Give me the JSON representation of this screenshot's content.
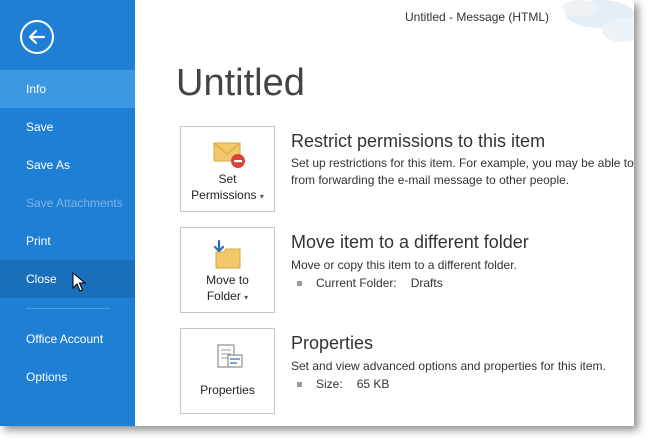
{
  "window": {
    "title": "Untitled - Message (HTML)"
  },
  "sidebar": {
    "back": "back-arrow-icon",
    "items": [
      {
        "label": "Info",
        "state": "active"
      },
      {
        "label": "Save",
        "state": "normal"
      },
      {
        "label": "Save As",
        "state": "normal"
      },
      {
        "label": "Save Attachments",
        "state": "disabled"
      },
      {
        "label": "Print",
        "state": "normal"
      },
      {
        "label": "Close",
        "state": "hover"
      },
      {
        "label": "Office Account",
        "state": "normal"
      },
      {
        "label": "Options",
        "state": "normal"
      }
    ],
    "colors": {
      "background": "#1f7fd4",
      "active": "#3d98e4",
      "hover": "#1a6fba"
    }
  },
  "main": {
    "title": "Untitled",
    "sections": [
      {
        "button_line1": "Set",
        "button_line2": "Permissions",
        "icon": "envelope-restrict-icon",
        "title": "Restrict permissions to this item",
        "desc_line1": "Set up restrictions for this item. For example, you may be able to r",
        "desc_line2": "from forwarding the e-mail message to other people."
      },
      {
        "button_line1": "Move to",
        "button_line2": "Folder",
        "icon": "move-folder-icon",
        "title": "Move item to a different folder",
        "desc_line1": "Move or copy this item to a different folder.",
        "detail_label": "Current Folder:",
        "detail_value": "Drafts"
      },
      {
        "button_line1": "Properties",
        "icon": "properties-icon",
        "title": "Properties",
        "desc_line1": "Set and view advanced options and properties for this item.",
        "detail_label": "Size:",
        "detail_value": "65 KB"
      }
    ]
  }
}
